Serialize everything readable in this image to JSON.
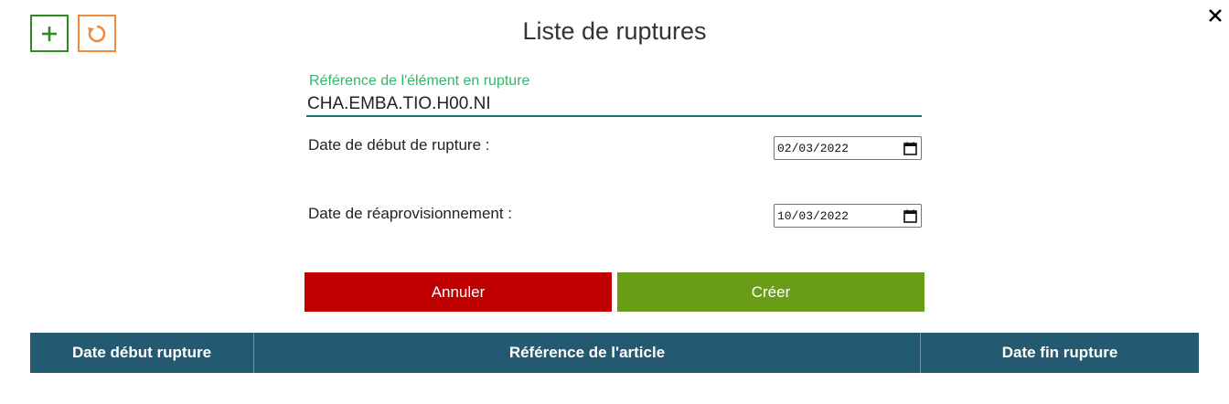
{
  "header": {
    "title": "Liste de ruptures",
    "add_icon": "plus-icon",
    "refresh_icon": "refresh-icon",
    "close_icon": "close-icon"
  },
  "form": {
    "reference_label": "Référence de l'élément en rupture",
    "reference_value": "CHA.EMBA.TIO.H00.NI",
    "start_label": "Date de début de rupture :",
    "start_value": "02/03/2022",
    "restock_label": "Date de réaprovisionnement :",
    "restock_value": "10/03/2022",
    "calendar_icon": "calendar-icon"
  },
  "actions": {
    "cancel_label": "Annuler",
    "create_label": "Créer"
  },
  "table": {
    "columns": [
      "Date début rupture",
      "Référence de l'article",
      "Date fin rupture"
    ]
  },
  "colors": {
    "add": "#2e8b1f",
    "refresh": "#f08a3c",
    "cancel": "#c00000",
    "create": "#699c17",
    "table_header": "#245972",
    "label_green": "#2fb86b"
  }
}
